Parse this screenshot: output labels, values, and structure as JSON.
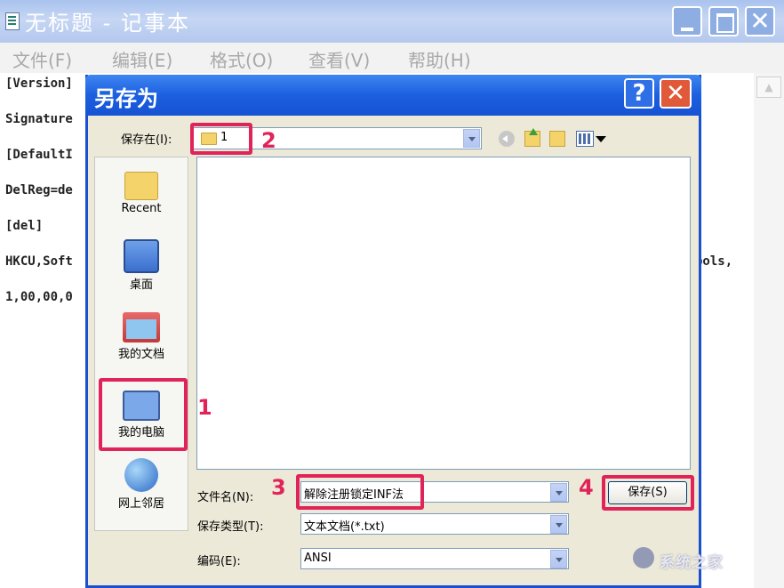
{
  "notepad": {
    "title": "无标题 - 记事本",
    "menu": [
      "文件(F)",
      "编辑(E)",
      "格式(O)",
      "查看(V)",
      "帮助(H)"
    ],
    "lines": [
      "[Version]",
      "Signature",
      "[DefaultI",
      "DelReg=de",
      "[del]",
      "HKCU,Soft",
      "1,00,00,0"
    ],
    "line_tail": "pols,"
  },
  "dialog": {
    "title": "另存为",
    "help_glyph": "?",
    "close_glyph": "✕",
    "save_in_label": "保存在(I):",
    "save_in_value": "1",
    "places": [
      {
        "label": "Recent",
        "icon": "recent-folder-icon"
      },
      {
        "label": "桌面",
        "icon": "desktop-icon"
      },
      {
        "label": "我的文档",
        "icon": "my-documents-icon"
      },
      {
        "label": "我的电脑",
        "icon": "my-computer-icon"
      },
      {
        "label": "网上邻居",
        "icon": "network-icon"
      }
    ],
    "filename_label": "文件名(N):",
    "filename_value": "解除注册锁定INF法",
    "filetype_label": "保存类型(T):",
    "filetype_value": "文本文档(*.txt)",
    "encoding_label": "编码(E):",
    "encoding_value": "ANSI",
    "save_button": "保存(S)"
  },
  "annotations": {
    "steps": [
      "1",
      "2",
      "3",
      "4"
    ],
    "color": "#e0245a"
  },
  "watermark": "系统之家"
}
